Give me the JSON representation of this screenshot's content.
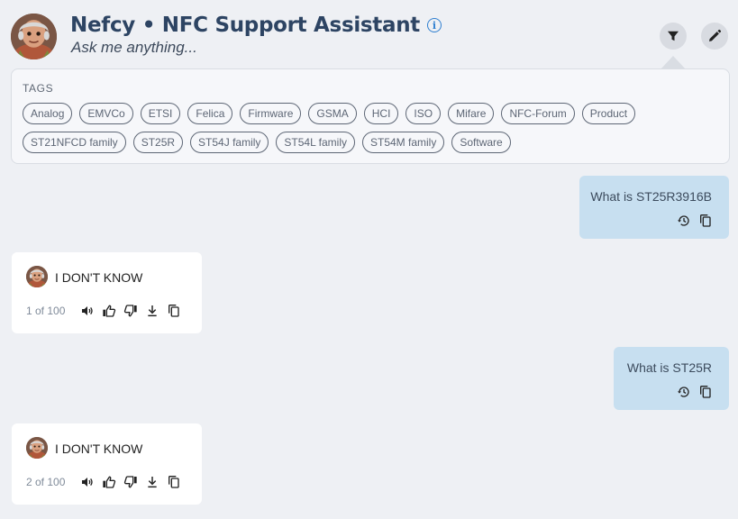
{
  "header": {
    "title": "Nefcy • NFC Support Assistant",
    "subtitle": "Ask me anything...",
    "icons": [
      "avatar",
      "info-icon",
      "filter-icon",
      "edit-icon"
    ]
  },
  "tags": {
    "label": "TAGS",
    "items": [
      "Analog",
      "EMVCo",
      "ETSI",
      "Felica",
      "Firmware",
      "GSMA",
      "HCI",
      "ISO",
      "Mifare",
      "NFC-Forum",
      "Product",
      "ST21NFCD family",
      "ST25R",
      "ST54J family",
      "ST54L family",
      "ST54M family",
      "Software"
    ]
  },
  "messages": [
    {
      "role": "user",
      "text": "What is ST25R3916B",
      "icons": [
        "history-icon",
        "copy-icon"
      ]
    },
    {
      "role": "bot",
      "text": "I DON'T KNOW",
      "counter": "1 of 100",
      "icons": [
        "speaker-icon",
        "thumbs-up-icon",
        "thumbs-down-icon",
        "download-icon",
        "copy-icon"
      ]
    },
    {
      "role": "user",
      "text": "What is ST25R",
      "icons": [
        "history-icon",
        "copy-icon"
      ]
    },
    {
      "role": "bot",
      "text": "I DON'T KNOW",
      "counter": "2 of 100",
      "icons": [
        "speaker-icon",
        "thumbs-up-icon",
        "thumbs-down-icon",
        "download-icon",
        "copy-icon"
      ]
    }
  ],
  "colors": {
    "title": "#2d4463",
    "accent": "#2f7fd0",
    "user_bubble": "#c7dff0",
    "bot_bubble": "#ffffff",
    "background": "#eef0f4"
  }
}
